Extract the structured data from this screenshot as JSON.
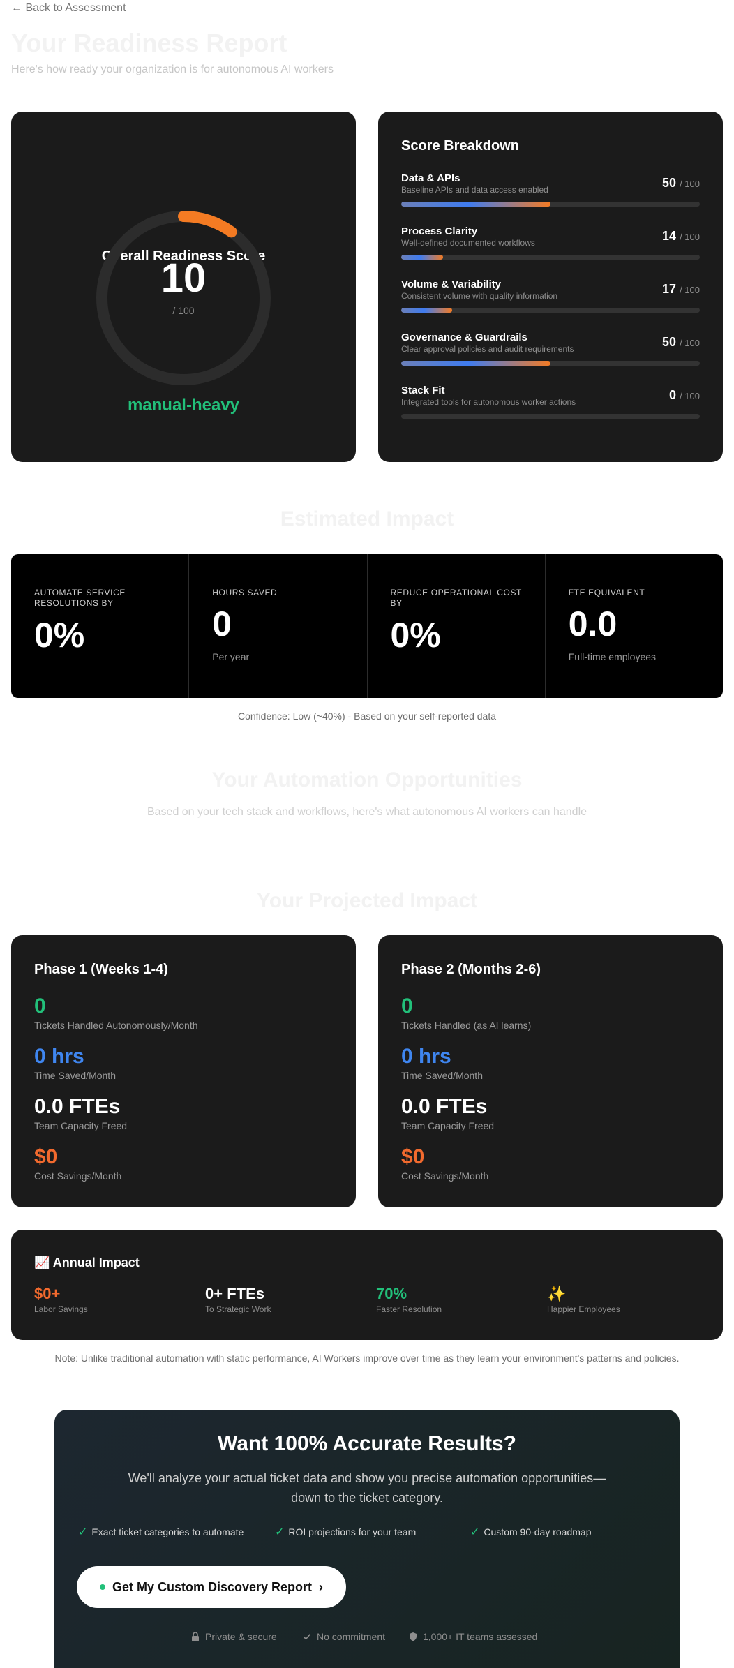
{
  "nav": {
    "back_label": "← Back to Assessment"
  },
  "header": {
    "title": "Your Readiness Report",
    "subtitle": "Here's how ready your organization is for autonomous AI workers"
  },
  "overall": {
    "title": "Overall Readiness Score",
    "score": "10",
    "max": "/ 100",
    "level": "manual-heavy",
    "fraction": 0.1
  },
  "breakdown": {
    "title": "Score Breakdown",
    "items": [
      {
        "name": "Data & APIs",
        "desc": "Baseline APIs and data access enabled",
        "score": "50",
        "max": "/ 100",
        "fraction": 0.5
      },
      {
        "name": "Process Clarity",
        "desc": "Well-defined documented workflows",
        "score": "14",
        "max": "/ 100",
        "fraction": 0.14
      },
      {
        "name": "Volume & Variability",
        "desc": "Consistent volume with quality information",
        "score": "17",
        "max": "/ 100",
        "fraction": 0.17
      },
      {
        "name": "Governance & Guardrails",
        "desc": "Clear approval policies and audit requirements",
        "score": "50",
        "max": "/ 100",
        "fraction": 0.5
      },
      {
        "name": "Stack Fit",
        "desc": "Integrated tools for autonomous worker actions",
        "score": "0",
        "max": "/ 100",
        "fraction": 0.0
      }
    ]
  },
  "impact": {
    "heading": "Estimated Impact",
    "cells": [
      {
        "label": "Automate service resolutions by",
        "value": "0%",
        "sub": ""
      },
      {
        "label": "Hours saved",
        "value": "0",
        "sub": "Per year"
      },
      {
        "label": "Reduce operational cost by",
        "value": "0%",
        "sub": ""
      },
      {
        "label": "FTE equivalent",
        "value": "0.0",
        "sub": "Full-time employees"
      }
    ],
    "confidence": "Confidence: Low (~40%) - Based on your self-reported data"
  },
  "opportunities": {
    "heading": "Your Automation Opportunities",
    "subtitle": "Based on your tech stack and workflows, here's what autonomous AI workers can handle"
  },
  "projected": {
    "heading": "Your Projected Impact",
    "phases": [
      {
        "title": "Phase 1 (Weeks 1-4)",
        "metrics": [
          {
            "value": "0",
            "label": "Tickets Handled Autonomously/Month",
            "color": "#22c07a"
          },
          {
            "value": "0 hrs",
            "label": "Time Saved/Month",
            "color": "#3f86f0"
          },
          {
            "value": "0.0 FTEs",
            "label": "Team Capacity Freed",
            "color": "#ffffff"
          },
          {
            "value": "$0",
            "label": "Cost Savings/Month",
            "color": "#f26a2e"
          }
        ]
      },
      {
        "title": "Phase 2 (Months 2-6)",
        "metrics": [
          {
            "value": "0",
            "label": "Tickets Handled (as AI learns)",
            "color": "#22c07a"
          },
          {
            "value": "0 hrs",
            "label": "Time Saved/Month",
            "color": "#3f86f0"
          },
          {
            "value": "0.0 FTEs",
            "label": "Team Capacity Freed",
            "color": "#ffffff"
          },
          {
            "value": "$0",
            "label": "Cost Savings/Month",
            "color": "#f26a2e"
          }
        ]
      }
    ]
  },
  "annual": {
    "title": "📈 Annual Impact",
    "stats": [
      {
        "value": "$0+",
        "label": "Labor Savings",
        "color": "#f26a2e"
      },
      {
        "value": "0+ FTEs",
        "label": "To Strategic Work",
        "color": "#ffffff"
      },
      {
        "value": "70%",
        "label": "Faster Resolution",
        "color": "#22c07a"
      },
      {
        "value": "✨",
        "label": "Happier Employees",
        "color": "#ffffff"
      }
    ],
    "note": "Note: Unlike traditional automation with static performance, AI Workers improve over time as they learn your environment's patterns and policies."
  },
  "cta": {
    "title": "Want 100% Accurate Results?",
    "description": "We'll analyze your actual ticket data and show you precise automation opportunities—down to the ticket category.",
    "checks": [
      "Exact ticket categories to automate",
      "ROI projections for your team",
      "Custom 90-day roadmap"
    ],
    "button_label": "Get My Custom Discovery Report",
    "trust": [
      "Private & secure",
      "No commitment",
      "1,000+ IT teams assessed"
    ]
  },
  "colors": {
    "accent_green": "#22c07a",
    "accent_blue": "#3f86f0",
    "accent_orange": "#f26a2e",
    "card_bg": "#1b1b1b"
  }
}
